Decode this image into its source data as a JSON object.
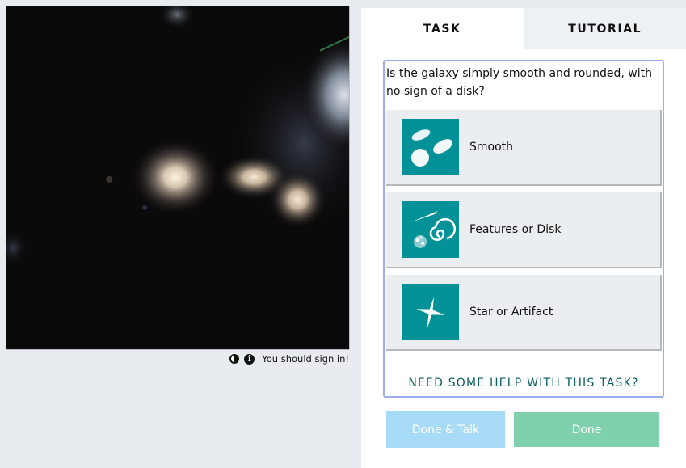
{
  "viewer": {
    "invert_icon": "contrast-icon",
    "info_icon": "info-icon",
    "info_glyph": "i",
    "signin_text": "You should sign in!"
  },
  "tabs": [
    {
      "label": "TASK",
      "active": true
    },
    {
      "label": "TUTORIAL",
      "active": false
    }
  ],
  "task": {
    "question": "Is the galaxy simply smooth and rounded, with no sign of a disk?",
    "answers": [
      {
        "label": "Smooth",
        "icon": "smooth-galaxy-icon"
      },
      {
        "label": "Features or Disk",
        "icon": "features-disk-icon"
      },
      {
        "label": "Star or Artifact",
        "icon": "star-artifact-icon"
      }
    ],
    "help_link": "NEED SOME HELP WITH THIS TASK?"
  },
  "buttons": {
    "done_talk": "Done & Talk",
    "done": "Done"
  },
  "colors": {
    "icon_bg": "#019196",
    "task_border": "#9eabef",
    "done_talk_bg": "#a7dbf8",
    "done_bg": "#7fd1ae",
    "help_link": "#0b5e62"
  }
}
